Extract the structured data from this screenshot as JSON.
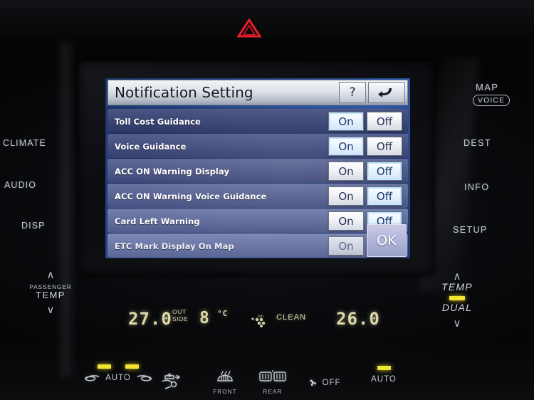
{
  "device": {
    "hazard_button": "hazard-triangle"
  },
  "screen": {
    "title": "Notification Setting",
    "help_label": "?",
    "back_label": "back-arrow",
    "ok_label": "OK",
    "toggle_on": "On",
    "toggle_off": "Off",
    "rows": [
      {
        "label": "Toll Cost Guidance",
        "selected": "On",
        "disabled": false
      },
      {
        "label": "Voice Guidance",
        "selected": "On",
        "disabled": false
      },
      {
        "label": "ACC ON Warning Display",
        "selected": "Off",
        "disabled": false
      },
      {
        "label": "ACC ON Warning Voice Guidance",
        "selected": "Off",
        "disabled": false
      },
      {
        "label": "Card Left Warning",
        "selected": "Off",
        "disabled": false
      },
      {
        "label": "ETC Mark Display On Map",
        "selected": "",
        "disabled": true
      }
    ]
  },
  "hardkeys": {
    "left": [
      {
        "id": "climate",
        "label": "CLIMATE"
      },
      {
        "id": "audio",
        "label": "AUDIO"
      },
      {
        "id": "disp",
        "label": "DISP"
      }
    ],
    "right": [
      {
        "id": "map",
        "label": "MAP"
      },
      {
        "id": "voice",
        "label": "VOICE"
      },
      {
        "id": "dest",
        "label": "DEST"
      },
      {
        "id": "info",
        "label": "INFO"
      },
      {
        "id": "setup",
        "label": "SETUP"
      }
    ]
  },
  "passenger_temp": {
    "up": "∧",
    "name": "PASSENGER",
    "label": "TEMP",
    "down": "∨"
  },
  "driver_temp": {
    "up": "∧",
    "label": "TEMP",
    "dual_label": "DUAL",
    "down": "∨"
  },
  "climate_display": {
    "left_temp": "27.0",
    "outside_line1": "OUT",
    "outside_line2": "SIDE",
    "ambient_temp": "8",
    "ambient_unit": "°C",
    "ion_icon": "ion-cluster-icon",
    "clean_label": "CLEAN",
    "right_temp": "26.0"
  },
  "bottom_buttons": [
    {
      "id": "auto-airflow",
      "label": "AUTO",
      "sub": "",
      "leds": 2
    },
    {
      "id": "air-recirculation",
      "label": "",
      "sub": "",
      "leds": 0
    },
    {
      "id": "front-defroster",
      "label": "",
      "sub": "FRONT",
      "leds": 0
    },
    {
      "id": "rear-defroster",
      "label": "",
      "sub": "REAR",
      "leds": 0
    },
    {
      "id": "fan-off",
      "label": "OFF",
      "sub": "",
      "leds": 0
    },
    {
      "id": "auto-climate",
      "label": "AUTO",
      "sub": "",
      "leds": 1
    }
  ],
  "colors": {
    "led_amber": "#f2e431",
    "hazard_red": "#e81f2d",
    "screen_blue": "#2d54a0",
    "ok_lavender": "#b3b7da",
    "lcd_amber": "#ddd8a8"
  }
}
